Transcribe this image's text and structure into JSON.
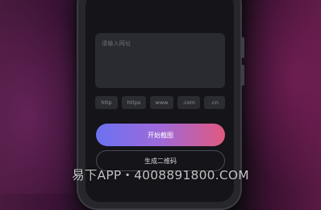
{
  "input": {
    "placeholder": "请输入网址"
  },
  "url_chips": [
    "http",
    "https",
    "www",
    ".com",
    ".cn"
  ],
  "buttons": {
    "primary_label": "开始截图",
    "secondary_label": "生成二维码"
  },
  "watermark": {
    "text": "易下APP・4008891800.COM"
  },
  "colors": {
    "primary_gradient_start": "#6b72f2",
    "primary_gradient_end": "#e0597f",
    "screen_background": "#141419",
    "field_background": "#2a2a31"
  }
}
